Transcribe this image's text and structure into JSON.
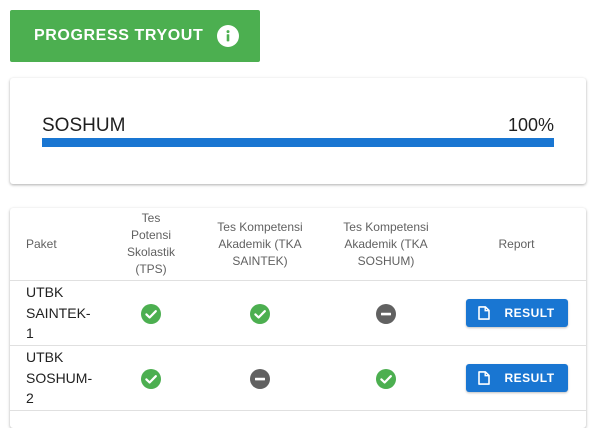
{
  "header": {
    "title": "PROGRESS TRYOUT",
    "info_icon": "info-icon"
  },
  "progress": {
    "label": "SOSHUM",
    "value_text": "100%",
    "fraction": 1.0,
    "color": "#1976d2"
  },
  "table": {
    "headers": {
      "paket": "Paket",
      "tps": "Tes Potensi Skolastik (TPS)",
      "tka_saintek": "Tes Kompetensi Akademik (TKA SAINTEK)",
      "tka_soshum": "Tes Kompetensi Akademik (TKA SOSHUM)",
      "report": "Report"
    },
    "rows": [
      {
        "paket": "UTBK SAINTEK-1",
        "tps": "done",
        "tka_saintek": "done",
        "tka_soshum": "not-available",
        "result_label": "RESULT"
      },
      {
        "paket": "UTBK SOSHUM-2",
        "tps": "done",
        "tka_saintek": "not-available",
        "tka_soshum": "done",
        "result_label": "RESULT"
      }
    ]
  },
  "colors": {
    "header_green": "#4caf50",
    "check_green": "#4caf50",
    "minus_grey": "#616161",
    "button_blue": "#1976d2"
  },
  "icons": {
    "done": "check-circle-icon",
    "not-available": "minus-circle-icon",
    "result": "document-icon"
  }
}
